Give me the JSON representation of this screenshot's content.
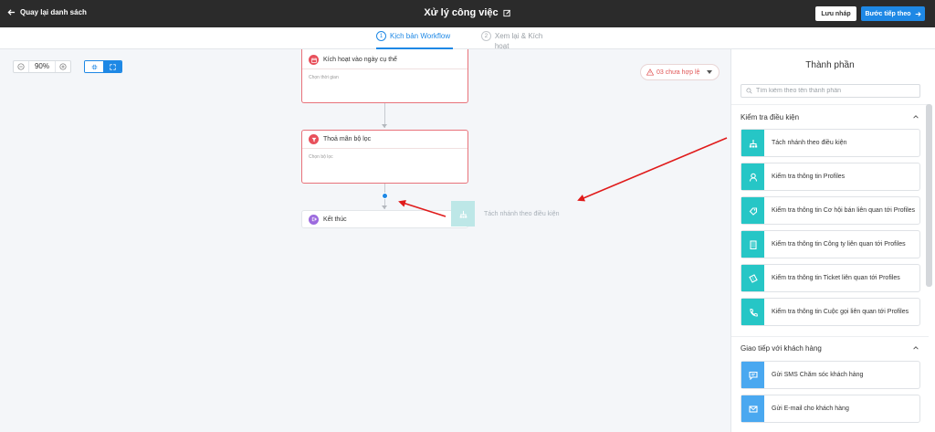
{
  "topbar": {
    "back_label": "Quay lại danh sách",
    "title": "Xử lý công việc",
    "draft_label": "Lưu nháp",
    "next_label": "Bước tiếp theo"
  },
  "steps": [
    {
      "num": "1",
      "label": "Kịch bản Workflow",
      "active": true
    },
    {
      "num": "2",
      "label": "Xem lại & Kích hoạt",
      "active": false
    }
  ],
  "canvas": {
    "zoom": "90%",
    "invalid_label": "03 chưa hợp lệ",
    "nodes": [
      {
        "title": "Kích hoạt vào ngày cụ thể",
        "sub": "Chọn thời gian",
        "icon": "calendar-icon",
        "color": "#e8505b"
      },
      {
        "title": "Thoả mãn bộ lọc",
        "sub": "Chọn bộ lọc",
        "icon": "filter-icon",
        "color": "#e8505b"
      },
      {
        "title": "Kết thúc",
        "icon": "exit-icon",
        "color": "#9c6ade"
      }
    ],
    "drag_ghost_label": "Tách nhánh theo điều kiện"
  },
  "panel": {
    "title": "Thành phần",
    "search_placeholder": "Tìm kiếm theo tên thành phần",
    "sections": [
      {
        "title": "Kiểm tra điều kiện",
        "items": [
          {
            "label": "Tách nhánh theo điều kiện",
            "icon": "branch-icon",
            "color": "#26c6c6"
          },
          {
            "label": "Kiểm tra thông tin Profiles",
            "icon": "user-icon",
            "color": "#26c6c6"
          },
          {
            "label": "Kiểm tra thông tin Cơ hội bán liên quan tới Profiles",
            "icon": "opportunity-icon",
            "color": "#26c6c6"
          },
          {
            "label": "Kiểm tra thông tin Công ty liên quan tới Profiles",
            "icon": "building-icon",
            "color": "#26c6c6"
          },
          {
            "label": "Kiểm tra thông tin Ticket liên quan tới Profiles",
            "icon": "ticket-icon",
            "color": "#26c6c6"
          },
          {
            "label": "Kiểm tra thông tin Cuộc gọi liên quan tới Profiles",
            "icon": "phone-icon",
            "color": "#26c6c6"
          }
        ]
      },
      {
        "title": "Giao tiếp với khách hàng",
        "items": [
          {
            "label": "Gửi SMS Chăm sóc khách hàng",
            "icon": "sms-icon",
            "color": "#4aa8f0"
          },
          {
            "label": "Gửi E-mail cho khách hàng",
            "icon": "email-icon",
            "color": "#4aa8f0"
          }
        ]
      }
    ]
  },
  "colors": {
    "accent": "#1e88e5",
    "topbar_bg": "#2b2b2b",
    "error": "#e8505b",
    "annotation_arrow": "#e01b1b"
  }
}
